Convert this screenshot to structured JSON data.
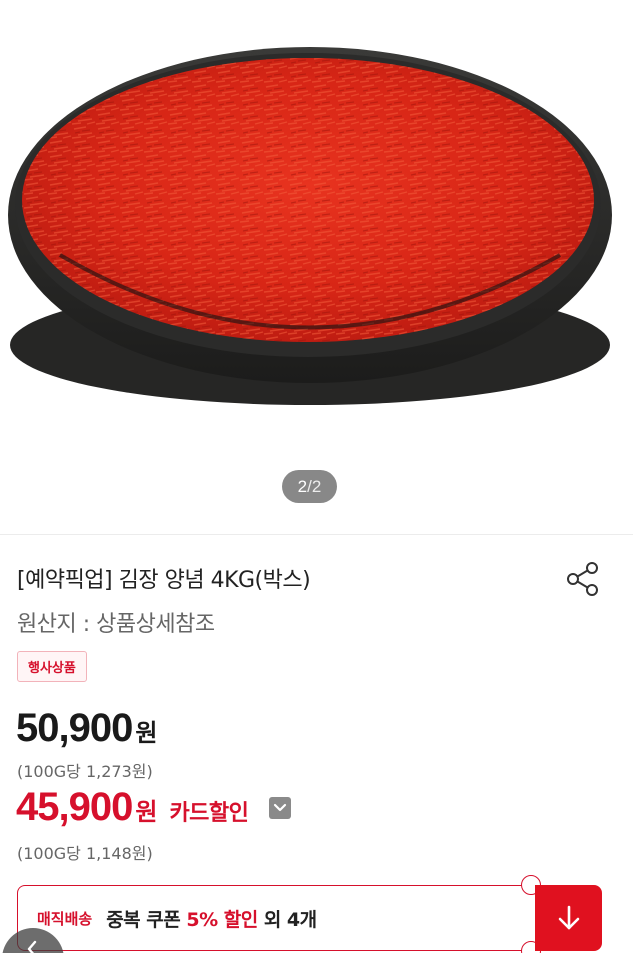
{
  "gallery": {
    "image_alt": "product-photo-kimchi-seasoning",
    "current": "2",
    "separator": "/",
    "total": "2"
  },
  "product": {
    "title": "[예약픽업] 김장 양념 4KG(박스)",
    "origin": "원산지 : 상품상세참조",
    "badge": "행사상품"
  },
  "pricing": {
    "regular_price": "50,900",
    "regular_currency": "원",
    "regular_unit_price": "(100G당 1,273원)",
    "sale_price": "45,900",
    "sale_currency": "원",
    "sale_label": "카드할인",
    "sale_unit_price": "(100G당 1,148원)"
  },
  "coupon_bar": {
    "tag": "매직배송",
    "text_prefix": "중복 쿠폰 ",
    "text_highlight": "5% 할인",
    "text_suffix": " 외 4개"
  },
  "icons": {
    "share": "share-icon",
    "dropdown": "chevron-down-icon",
    "download": "arrow-down-icon",
    "back": "chevron-left-icon"
  },
  "colors": {
    "accent": "#d6102c",
    "button": "#e0111f",
    "text": "#222222",
    "muted": "#666666"
  }
}
